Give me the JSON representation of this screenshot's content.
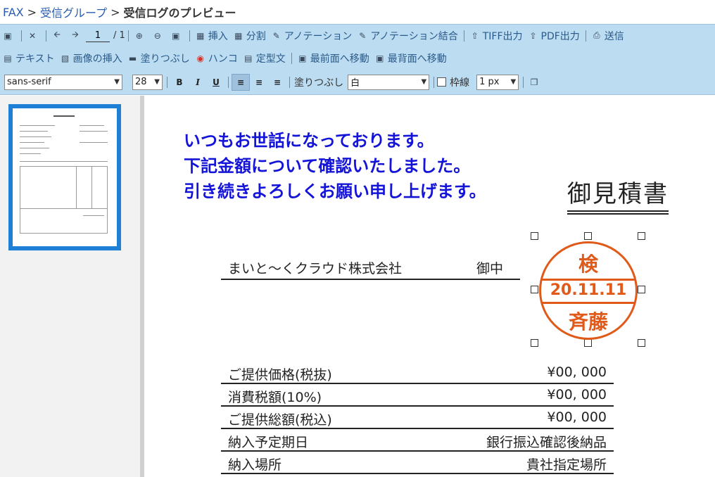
{
  "breadcrumb": {
    "root": "FAX",
    "sep1": ">",
    "group": "受信グループ",
    "sep2": ">",
    "current": "受信ログのプレビュー"
  },
  "toolbar1": {
    "page_current": "1",
    "page_total": "/ 1",
    "insert": "挿入",
    "split": "分割",
    "annotation": "アノテーション",
    "annotation_merge": "アノテーション結合",
    "tiff": "TIFF出力",
    "pdf": "PDF出力",
    "send": "送信"
  },
  "toolbar2": {
    "text": "テキスト",
    "insert_image": "画像の挿入",
    "fill": "塗りつぶし",
    "hanko": "ハンコ",
    "template": "定型文",
    "bring_front": "最前面へ移動",
    "send_back": "最背面へ移動"
  },
  "toolbar3": {
    "font": "sans-serif",
    "size": "28",
    "bold": "B",
    "italic": "I",
    "underline": "U",
    "fill_label": "塗りつぶし",
    "fill_value": "白",
    "border_label": "枠線",
    "border_width": "1 px"
  },
  "document": {
    "note_lines": [
      "いつもお世話になっております。",
      "下記金額について確認いたしました。",
      "引き続きよろしくお願い申し上げます。"
    ],
    "title": "御見積書",
    "recipient": "まいと～くクラウド株式会社",
    "honorific": "御中",
    "stamp": {
      "top": "検",
      "date": "20.11.11",
      "name": "斉藤"
    },
    "rows": [
      {
        "key": "ご提供価格(税抜)",
        "value": "¥00, 000"
      },
      {
        "key": "消費税額(10%)",
        "value": "¥00, 000"
      },
      {
        "key": "ご提供総額(税込)",
        "value": "¥00, 000"
      },
      {
        "key": "納入予定期日",
        "value": "銀行振込確認後納品"
      },
      {
        "key": "納入場所",
        "value": "貴社指定場所"
      }
    ]
  },
  "colors": {
    "toolbar_bg": "#bcdcf2",
    "note_text": "#1414d8",
    "stamp": "#e05a1a",
    "thumb_border": "#1f7fd4",
    "link": "#2a5db0"
  }
}
